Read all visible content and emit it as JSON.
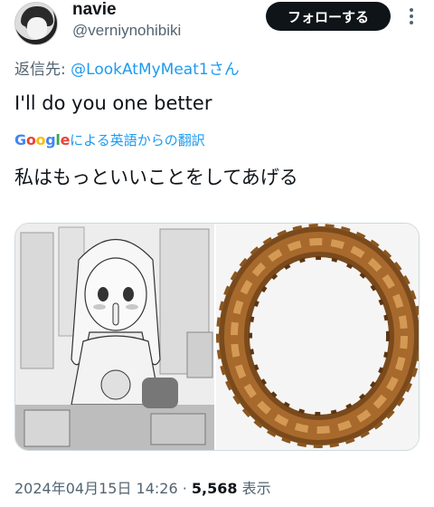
{
  "author": {
    "display_name": "navie",
    "handle": "@verniynohibiki",
    "avatar_icon": "anime-girl-avatar"
  },
  "header": {
    "follow_label": "フォローする",
    "more_icon": "more-vertical-icon"
  },
  "reply": {
    "prefix": "返信先: ",
    "mention": "@LookAtMyMeat1さん"
  },
  "tweet": {
    "text": "I'll do you one better"
  },
  "translation": {
    "provider_letters": [
      "G",
      "o",
      "o",
      "g",
      "l",
      "e"
    ],
    "label": "による英語からの翻訳",
    "text": "私はもっといいことをしてあげる"
  },
  "media": {
    "left_icon": "manga-illustration-image",
    "right_icon": "onion-ring-photo"
  },
  "meta": {
    "timestamp": "2024年04月15日 14:26",
    "separator": " · ",
    "views_count": "5,568",
    "views_label": " 表示"
  },
  "colors": {
    "accent": "#1d9bf0",
    "text_primary": "#0f1419",
    "text_secondary": "#536471",
    "follow_bg": "#0f1419"
  }
}
